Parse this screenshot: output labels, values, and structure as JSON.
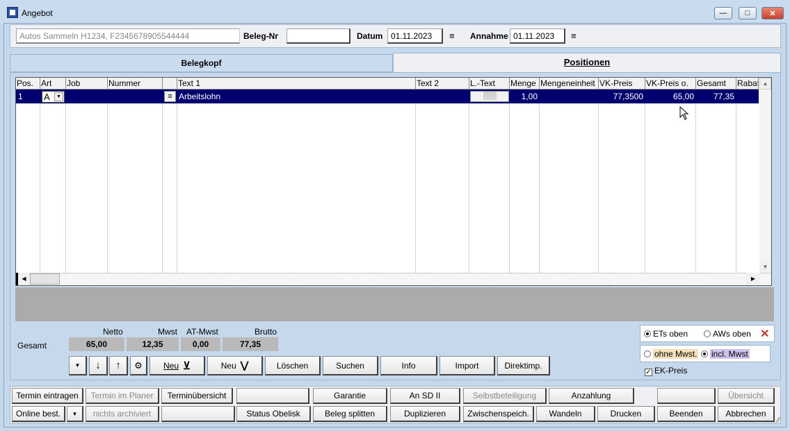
{
  "window": {
    "title": "Angebot",
    "app_icon": "app-icon"
  },
  "header": {
    "customer_value": "Autos Sammeln H1234, F2345678905544444",
    "beleg_label": "Beleg-Nr",
    "beleg_value": "",
    "datum_label": "Datum",
    "datum_value": "01.11.2023",
    "annahme_label": "Annahme",
    "annahme_value": "01.11.2023"
  },
  "tabs": [
    {
      "label": "Belegkopf",
      "active": false
    },
    {
      "label": "Positionen",
      "active": true
    }
  ],
  "table": {
    "columns": [
      "Pos.",
      "Art",
      "Job",
      "Nummer",
      "",
      "Text 1",
      "Text 2",
      "L.-Text",
      "Menge",
      "Mengeneinheit",
      "VK-Preis",
      "VK-Preis o.",
      "Gesamt",
      "Rabatt"
    ],
    "rows": [
      {
        "pos": "1",
        "art": "A",
        "job": "",
        "nummer": "",
        "text1": "Arbeitslohn",
        "text2": "",
        "menge": "1,00",
        "einheit": "",
        "vk": "77,3500",
        "vko": "65,00",
        "gesamt": "77,35",
        "rabatt": ""
      }
    ]
  },
  "totals": {
    "row_label": "Gesamt",
    "netto_label": "Netto",
    "mwst_label": "Mwst",
    "atmwst_label": "AT-Mwst",
    "brutto_label": "Brutto",
    "netto": "65,00",
    "mwst": "12,35",
    "atmwst": "0,00",
    "brutto": "77,35"
  },
  "options": {
    "ets_oben": "ETs oben",
    "aws_oben": "AWs oben",
    "ohne_mwst": "ohne Mwst.",
    "incl_mwst": "incl. Mwst",
    "ek_preis": "EK-Preis"
  },
  "toolbar": {
    "neu1": "Neu",
    "neu2": "Neu",
    "loeschen": "Löschen",
    "suchen": "Suchen",
    "info": "Info",
    "import": "Import",
    "direktimp": "Direktimp."
  },
  "bottom_row1": [
    "Termin eintragen",
    "Termin im Planer",
    "Terminübersicht",
    "",
    "Garantie",
    "An SD II",
    "Selbstbeteiligung",
    "Anzahlung",
    "",
    "Übersicht"
  ],
  "bottom_row2": [
    "Online best.",
    "nichts archiviert",
    "",
    "Status Obelisk",
    "Beleg splitten",
    "Duplizieren",
    "Zwischenspeich.",
    "Wandeln",
    "Drucken",
    "Beenden",
    "Abbrechen"
  ],
  "colors": {
    "selection": "#00006e",
    "close": "#c0392b"
  }
}
